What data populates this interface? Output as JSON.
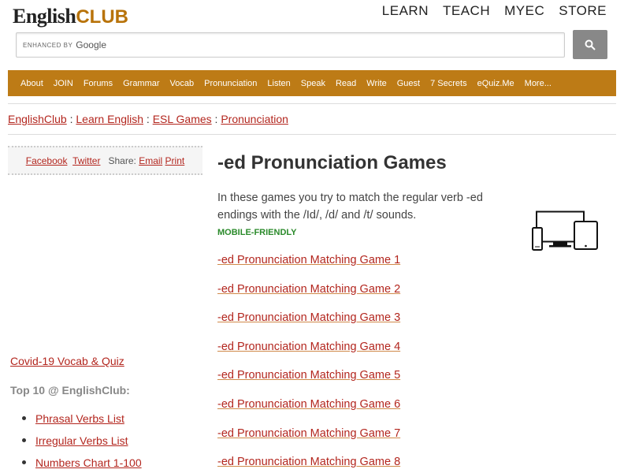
{
  "logo": {
    "english": "English",
    "club": "CLUB"
  },
  "topnav": [
    "LEARN",
    "TEACH",
    "MYEC",
    "STORE"
  ],
  "search": {
    "enhanced_by": "ENHANCED BY",
    "provider": "Google",
    "button_icon": "search-icon"
  },
  "menu": [
    "About",
    "JOIN",
    "Forums",
    "Grammar",
    "Vocab",
    "Pronunciation",
    "Listen",
    "Speak",
    "Read",
    "Write",
    "Guest",
    "7 Secrets",
    "eQuiz.Me",
    "More..."
  ],
  "breadcrumb": [
    {
      "label": "EnglishClub"
    },
    {
      "label": "Learn English"
    },
    {
      "label": "ESL Games"
    },
    {
      "label": "Pronunciation"
    }
  ],
  "breadcrumb_sep": ":",
  "share": {
    "facebook": "Facebook",
    "twitter": "Twitter",
    "share_label": "Share:",
    "email": "Email",
    "print": "Print"
  },
  "sidebar": {
    "covid_link": "Covid-19 Vocab & Quiz",
    "top10_heading": "Top 10 @ EnglishClub:",
    "top10_items": [
      "Phrasal Verbs List",
      "Irregular Verbs List",
      "Numbers Chart 1-100"
    ]
  },
  "main": {
    "title": "-ed Pronunciation Games",
    "intro": "In these games you try to match the regular verb -ed endings with the /Id/, /d/ and /t/ sounds.",
    "mobile_label": "MOBILE-FRIENDLY",
    "games": [
      "-ed Pronunciation Matching Game 1",
      "-ed Pronunciation Matching Game 2",
      "-ed Pronunciation Matching Game 3",
      "-ed Pronunciation Matching Game 4",
      "-ed Pronunciation Matching Game 5",
      "-ed Pronunciation Matching Game 6",
      "-ed Pronunciation Matching Game 7",
      "-ed Pronunciation Matching Game 8"
    ]
  },
  "colors": {
    "accent": "#bd7b16",
    "link": "#b3261e",
    "mobile": "#2a8a2a"
  }
}
